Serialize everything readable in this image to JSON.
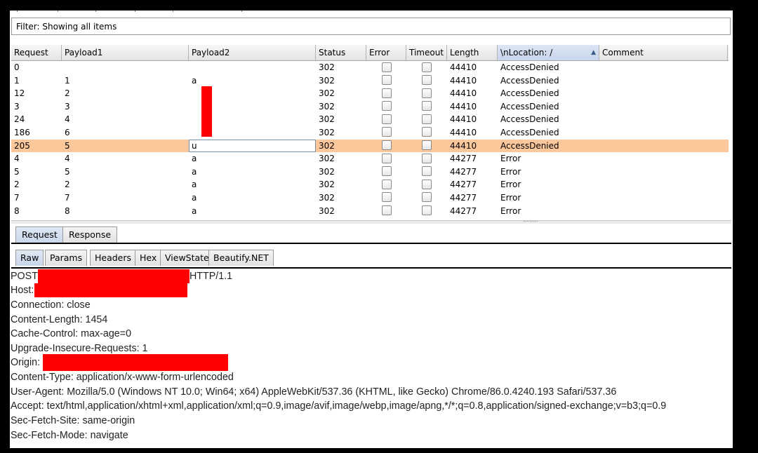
{
  "filter": {
    "text": "Filter: Showing all items"
  },
  "table": {
    "columns": [
      "Request",
      "Payload1",
      "Payload2",
      "Status",
      "Error",
      "Timeout",
      "Length",
      "\\nLocation: /",
      "Comment"
    ],
    "sorted_column": "\\nLocation: /",
    "sort_indicator": "▲",
    "rows": [
      {
        "request": "0",
        "payload1": "",
        "payload2": "",
        "status": "302",
        "error": false,
        "timeout": false,
        "length": "44410",
        "location": "AccessDenied",
        "comment": ""
      },
      {
        "request": "1",
        "payload1": "1",
        "payload2": "a",
        "status": "302",
        "error": false,
        "timeout": false,
        "length": "44410",
        "location": "AccessDenied",
        "comment": ""
      },
      {
        "request": "12",
        "payload1": "2",
        "payload2": "",
        "status": "302",
        "error": false,
        "timeout": false,
        "length": "44410",
        "location": "AccessDenied",
        "comment": ""
      },
      {
        "request": "3",
        "payload1": "3",
        "payload2": "",
        "status": "302",
        "error": false,
        "timeout": false,
        "length": "44410",
        "location": "AccessDenied",
        "comment": ""
      },
      {
        "request": "24",
        "payload1": "4",
        "payload2": "",
        "status": "302",
        "error": false,
        "timeout": false,
        "length": "44410",
        "location": "AccessDenied",
        "comment": ""
      },
      {
        "request": "186",
        "payload1": "6",
        "payload2": "",
        "status": "302",
        "error": false,
        "timeout": false,
        "length": "44410",
        "location": "AccessDenied",
        "comment": ""
      },
      {
        "request": "205",
        "payload1": "5",
        "payload2": "u",
        "status": "302",
        "error": false,
        "timeout": false,
        "length": "44410",
        "location": "AccessDenied",
        "comment": "",
        "selected": true
      },
      {
        "request": "4",
        "payload1": "4",
        "payload2": "a",
        "status": "302",
        "error": false,
        "timeout": false,
        "length": "44277",
        "location": "Error",
        "comment": ""
      },
      {
        "request": "5",
        "payload1": "5",
        "payload2": "a",
        "status": "302",
        "error": false,
        "timeout": false,
        "length": "44277",
        "location": "Error",
        "comment": ""
      },
      {
        "request": "2",
        "payload1": "2",
        "payload2": "a",
        "status": "302",
        "error": false,
        "timeout": false,
        "length": "44277",
        "location": "Error",
        "comment": ""
      },
      {
        "request": "7",
        "payload1": "7",
        "payload2": "a",
        "status": "302",
        "error": false,
        "timeout": false,
        "length": "44277",
        "location": "Error",
        "comment": ""
      },
      {
        "request": "8",
        "payload1": "8",
        "payload2": "a",
        "status": "302",
        "error": false,
        "timeout": false,
        "length": "44277",
        "location": "Error",
        "comment": ""
      }
    ]
  },
  "message_tabs": [
    {
      "label": "Request",
      "active": true
    },
    {
      "label": "Response",
      "active": false
    }
  ],
  "view_tabs": [
    {
      "label": "Raw",
      "active": true
    },
    {
      "label": "Params",
      "active": false
    },
    {
      "label": "Headers",
      "active": false
    },
    {
      "label": "Hex",
      "active": false
    },
    {
      "label": "ViewState",
      "active": false
    },
    {
      "label": "Beautify.NET",
      "active": false
    }
  ],
  "raw_request": {
    "line1_method": "POST",
    "line1_protocol": "HTTP/1.1",
    "host_label": "Host:",
    "connection": "Connection: close",
    "content_length": "Content-Length: 1454",
    "cache_control": "Cache-Control: max-age=0",
    "upgrade": "Upgrade-Insecure-Requests: 1",
    "origin_label": "Origin:",
    "content_type": "Content-Type: application/x-www-form-urlencoded",
    "user_agent": "User-Agent: Mozilla/5.0 (Windows NT 10.0; Win64; x64) AppleWebKit/537.36 (KHTML, like Gecko) Chrome/86.0.4240.193 Safari/537.36",
    "accept": "Accept: text/html,application/xhtml+xml,application/xml;q=0.9,image/avif,image/webp,image/apng,*/*;q=0.8,application/signed-exchange;v=b3;q=0.9",
    "sec_fetch_site": "Sec-Fetch-Site: same-origin",
    "sec_fetch_mode": "Sec-Fetch-Mode: navigate"
  },
  "colors": {
    "selected_row": "#fcc79b",
    "redaction": "#ff0000",
    "background": "#000000"
  }
}
